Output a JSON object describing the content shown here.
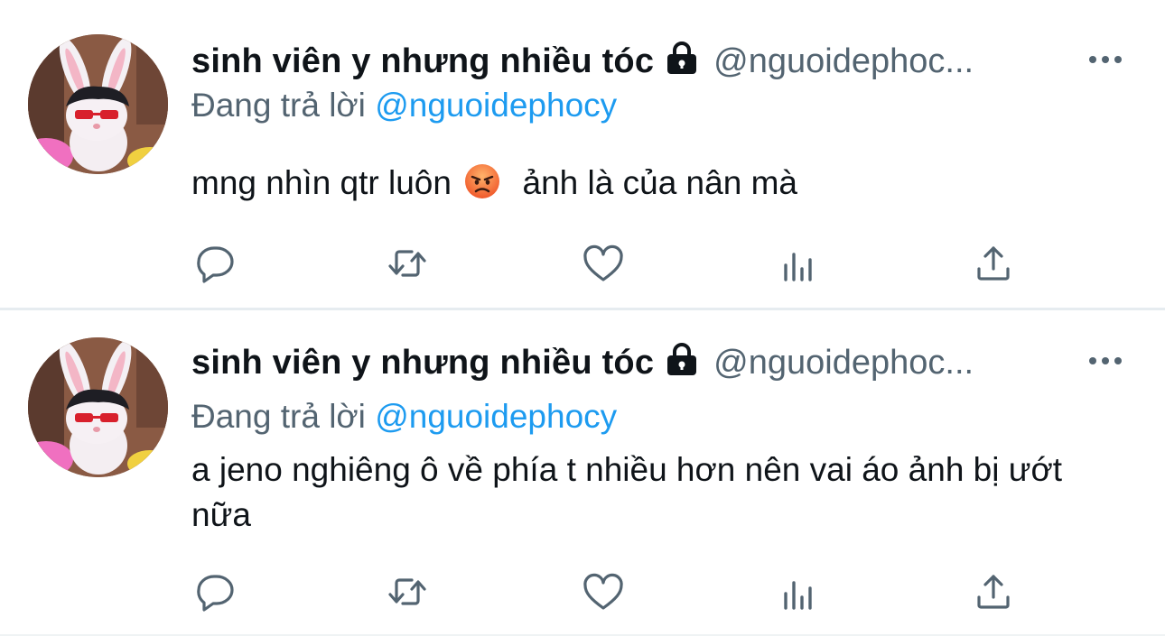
{
  "tweets": [
    {
      "display_name": "sinh viên y nhưng nhiều tóc",
      "handle": "@nguoidephoc...",
      "replying_prefix": "Đang trả lời",
      "replying_to": "@nguoidephocy",
      "text_before_emoji": "mng nhìn qtr luôn",
      "emoji": "angry-face-emoji",
      "text_after_emoji": "ảnh là của nân mà",
      "actions": [
        "reply-icon",
        "retweet-icon",
        "like-icon",
        "analytics-icon",
        "share-icon"
      ]
    },
    {
      "display_name": "sinh viên y nhưng nhiều tóc",
      "handle": "@nguoidephoc...",
      "replying_prefix": "Đang trả lời",
      "replying_to": "@nguoidephocy",
      "text": "a jeno nghiêng ô về phía t nhiều hơn nên vai áo ảnh bị ướt nữa",
      "actions": [
        "reply-icon",
        "retweet-icon",
        "like-icon",
        "analytics-icon",
        "share-icon"
      ]
    }
  ],
  "colors": {
    "text_primary": "#0f1419",
    "text_secondary": "#536471",
    "mention": "#1d9bf0",
    "icon": "#536471",
    "divider": "#e6ecf0"
  }
}
